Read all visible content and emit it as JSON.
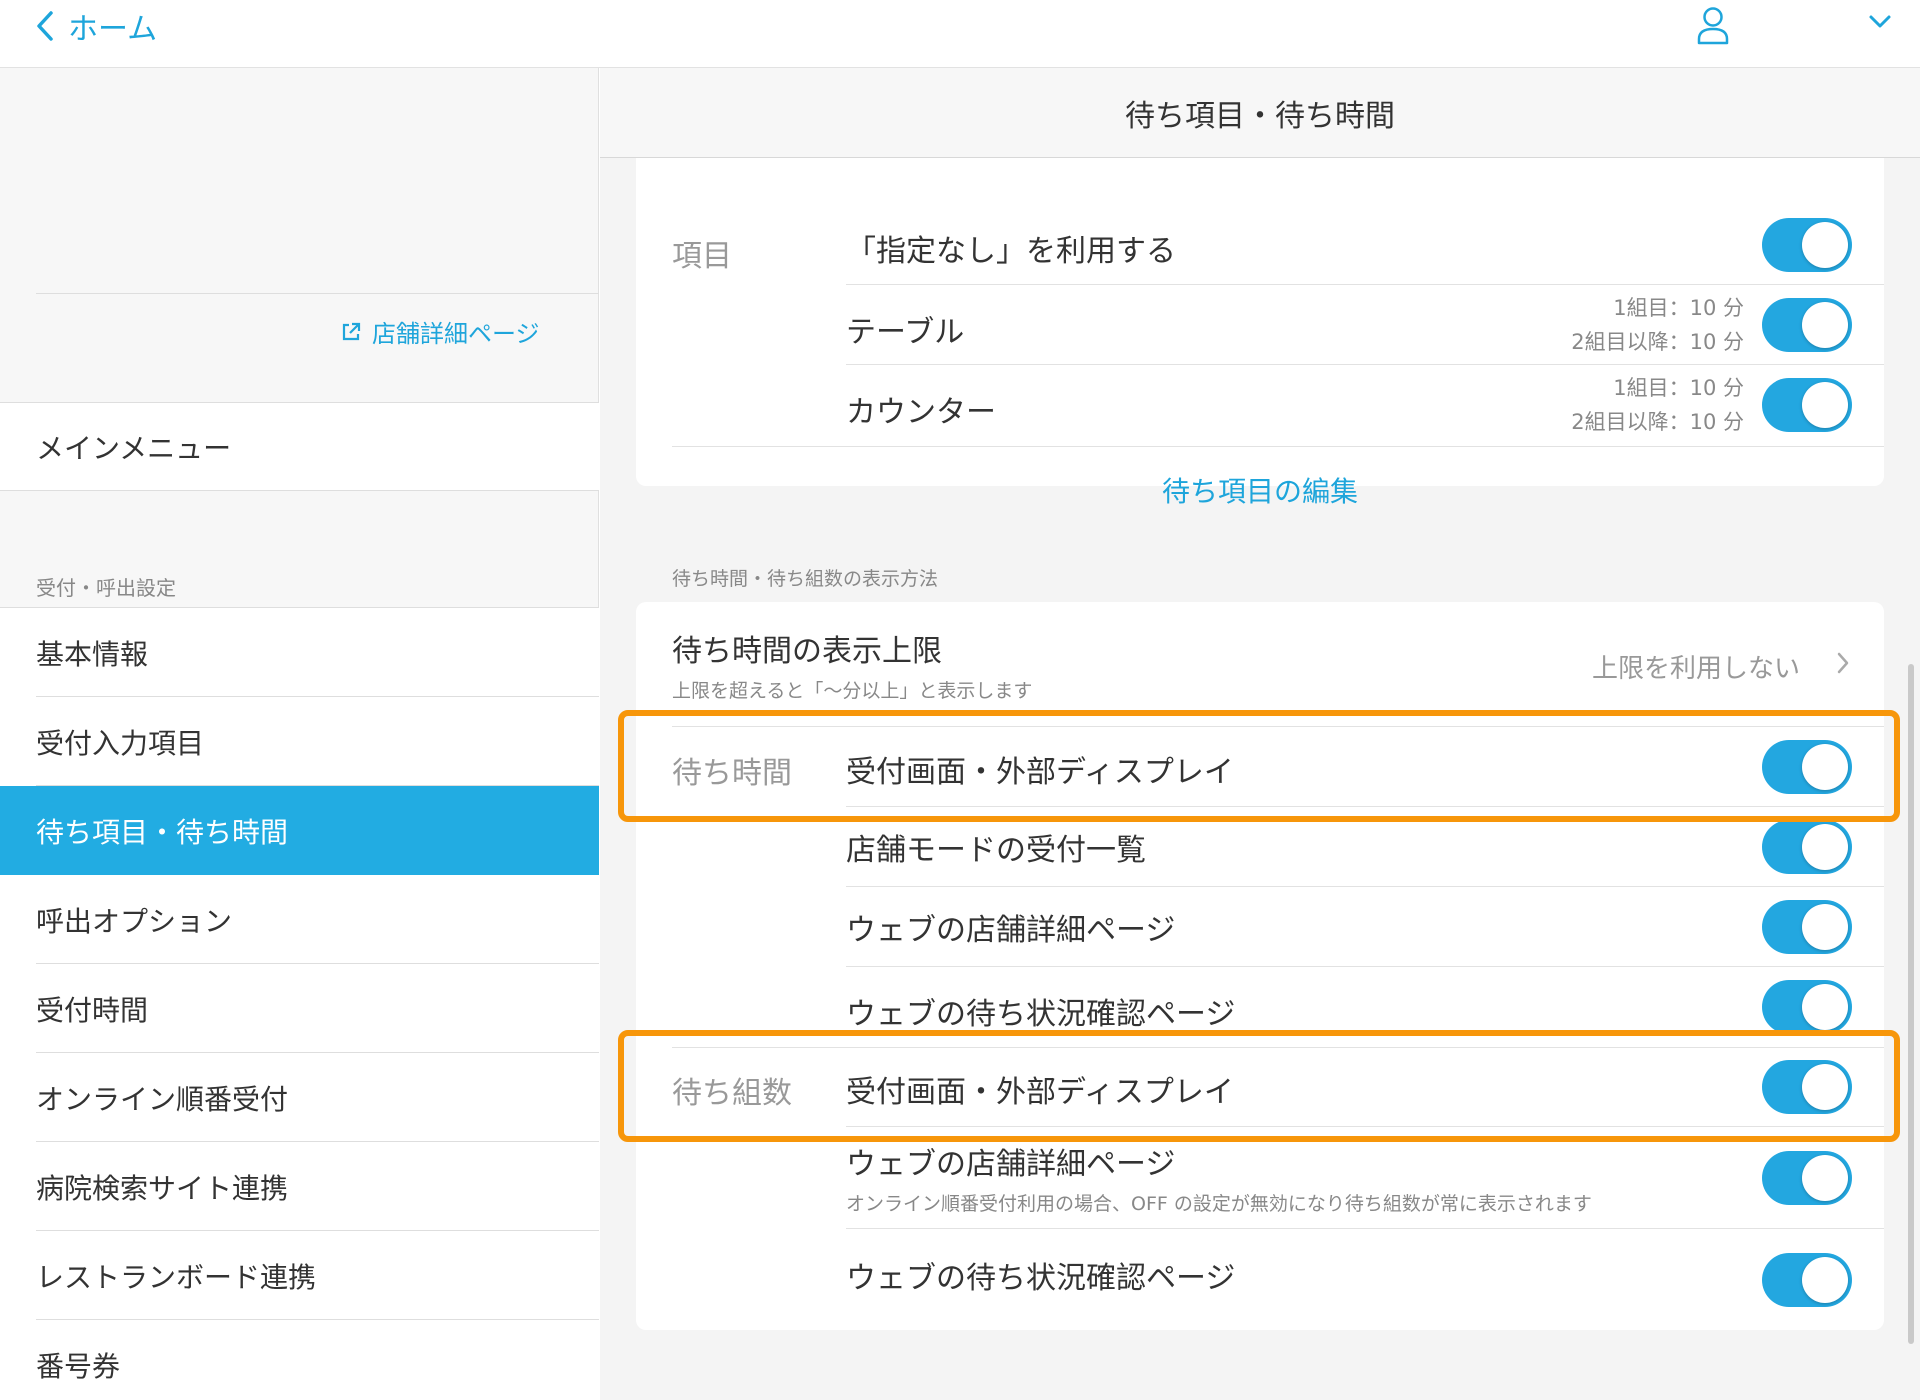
{
  "topbar": {
    "back_label": "ホーム"
  },
  "sidebar": {
    "store_detail_link": "店舗詳細ページ",
    "main_menu": "メインメニュー",
    "section_label": "受付・呼出設定",
    "items": [
      {
        "label": "基本情報",
        "active": false
      },
      {
        "label": "受付入力項目",
        "active": false
      },
      {
        "label": "待ち項目・待ち時間",
        "active": true
      },
      {
        "label": "呼出オプション",
        "active": false
      },
      {
        "label": "受付時間",
        "active": false
      },
      {
        "label": "オンライン順番受付",
        "active": false
      },
      {
        "label": "病院検索サイト連携",
        "active": false
      },
      {
        "label": "レストランボード連携",
        "active": false
      },
      {
        "label": "番号券",
        "active": false
      }
    ]
  },
  "main": {
    "title": "待ち項目・待ち時間",
    "items_card": {
      "group_label": "項目",
      "rows": [
        {
          "label": "「指定なし」を利用する",
          "toggle": true
        },
        {
          "label": "テーブル",
          "line1": "1組目：10 分",
          "line2": "2組目以降：10 分",
          "toggle": true
        },
        {
          "label": "カウンター",
          "line1": "1組目：10 分",
          "line2": "2組目以降：10 分",
          "toggle": true
        }
      ],
      "edit_link": "待ち項目の編集"
    },
    "display_section_title": "待ち時間・待ち組数の表示方法",
    "display_card": {
      "limit_title": "待ち時間の表示上限",
      "limit_sub": "上限を超えると「〜分以上」と表示します",
      "limit_value": "上限を利用しない",
      "wait_time_label": "待ち時間",
      "wait_time_rows": [
        {
          "label": "受付画面・外部ディスプレイ",
          "toggle": true
        },
        {
          "label": "店舗モードの受付一覧",
          "toggle": true
        },
        {
          "label": "ウェブの店舗詳細ページ",
          "toggle": true
        },
        {
          "label": "ウェブの待ち状況確認ページ",
          "toggle": true
        }
      ],
      "wait_count_label": "待ち組数",
      "wait_count_rows": [
        {
          "label": "受付画面・外部ディスプレイ",
          "toggle": true
        },
        {
          "label": "ウェブの店舗詳細ページ",
          "sub": "オンライン順番受付利用の場合、OFF の設定が無効になり待ち組数が常に表示されます",
          "toggle": true
        },
        {
          "label": "ウェブの待ち状況確認ページ",
          "toggle": true
        }
      ]
    }
  },
  "colors": {
    "accent": "#22ace2",
    "toggle_on": "#23a7e0",
    "highlight": "#f7960a"
  }
}
